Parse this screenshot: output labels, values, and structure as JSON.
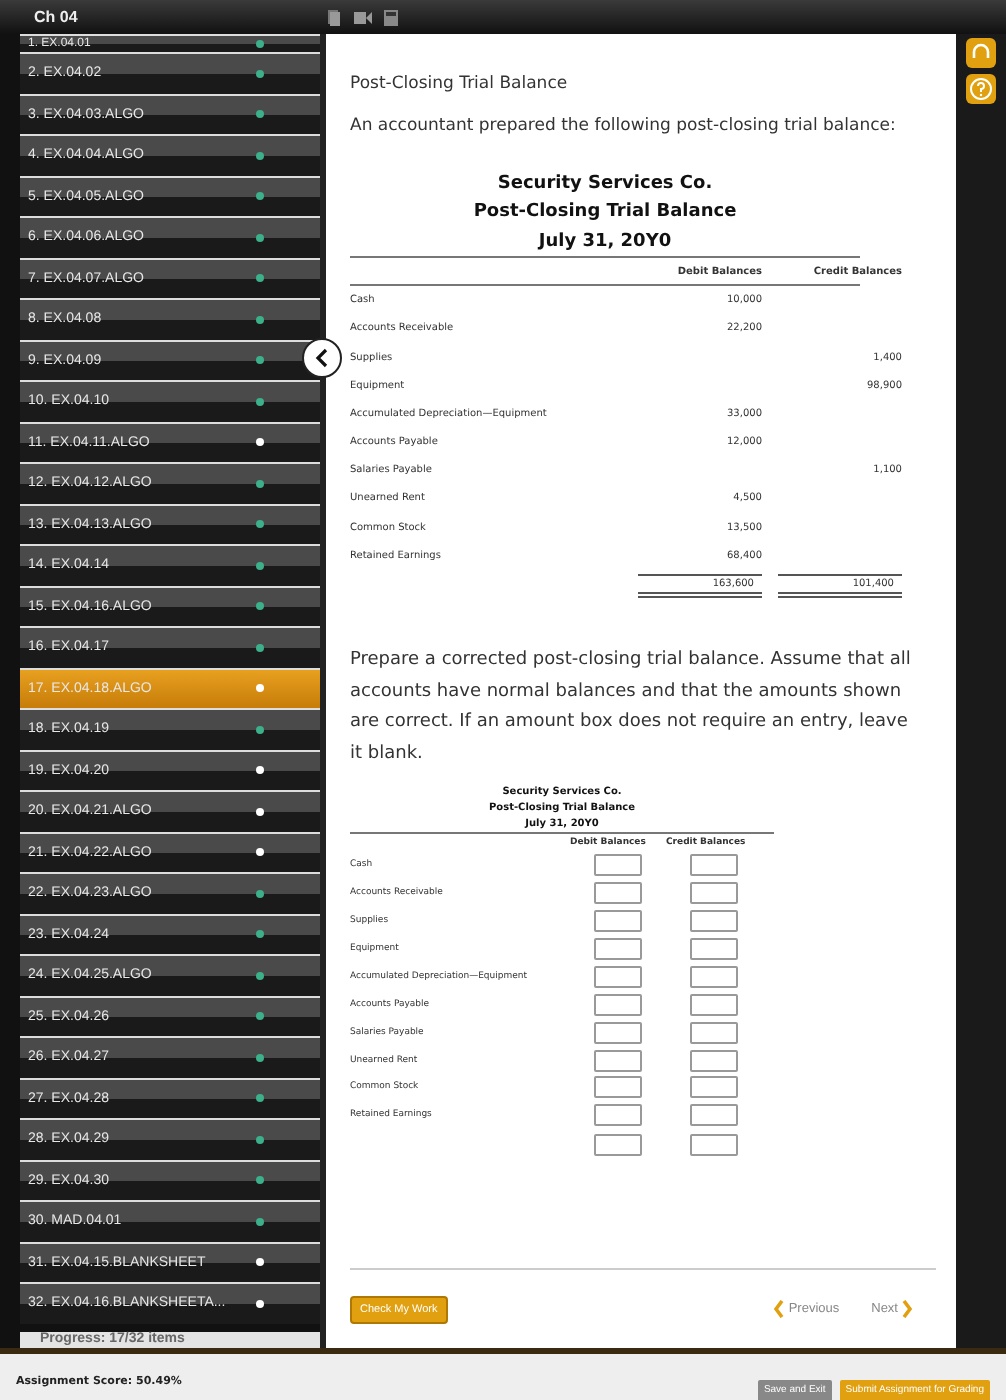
{
  "top_bar": {
    "title": "Ch 04"
  },
  "sidebar": {
    "items": [
      {
        "label": "1. EX.04.01",
        "completed": true,
        "selected": false
      },
      {
        "label": "2. EX.04.02",
        "completed": true,
        "selected": false
      },
      {
        "label": "3. EX.04.03.ALGO",
        "completed": true,
        "selected": false
      },
      {
        "label": "4. EX.04.04.ALGO",
        "completed": true,
        "selected": false
      },
      {
        "label": "5. EX.04.05.ALGO",
        "completed": true,
        "selected": false
      },
      {
        "label": "6. EX.04.06.ALGO",
        "completed": true,
        "selected": false
      },
      {
        "label": "7. EX.04.07.ALGO",
        "completed": true,
        "selected": false
      },
      {
        "label": "8. EX.04.08",
        "completed": true,
        "selected": false
      },
      {
        "label": "9. EX.04.09",
        "completed": true,
        "selected": false
      },
      {
        "label": "10. EX.04.10",
        "completed": true,
        "selected": false
      },
      {
        "label": "11. EX.04.11.ALGO",
        "completed": false,
        "selected": false
      },
      {
        "label": "12. EX.04.12.ALGO",
        "completed": true,
        "selected": false
      },
      {
        "label": "13. EX.04.13.ALGO",
        "completed": true,
        "selected": false
      },
      {
        "label": "14. EX.04.14",
        "completed": true,
        "selected": false
      },
      {
        "label": "15. EX.04.16.ALGO",
        "completed": true,
        "selected": false
      },
      {
        "label": "16. EX.04.17",
        "completed": true,
        "selected": false
      },
      {
        "label": "17. EX.04.18.ALGO",
        "completed": false,
        "selected": true
      },
      {
        "label": "18. EX.04.19",
        "completed": true,
        "selected": false
      },
      {
        "label": "19. EX.04.20",
        "completed": false,
        "selected": false
      },
      {
        "label": "20. EX.04.21.ALGO",
        "completed": false,
        "selected": false
      },
      {
        "label": "21. EX.04.22.ALGO",
        "completed": false,
        "selected": false
      },
      {
        "label": "22. EX.04.23.ALGO",
        "completed": true,
        "selected": false
      },
      {
        "label": "23. EX.04.24",
        "completed": true,
        "selected": false
      },
      {
        "label": "24. EX.04.25.ALGO",
        "completed": true,
        "selected": false
      },
      {
        "label": "25. EX.04.26",
        "completed": true,
        "selected": false
      },
      {
        "label": "26. EX.04.27",
        "completed": true,
        "selected": false
      },
      {
        "label": "27. EX.04.28",
        "completed": true,
        "selected": false
      },
      {
        "label": "28. EX.04.29",
        "completed": true,
        "selected": false
      },
      {
        "label": "29. EX.04.30",
        "completed": true,
        "selected": false
      },
      {
        "label": "30. MAD.04.01",
        "completed": true,
        "selected": false
      },
      {
        "label": "31. EX.04.15.BLANKSHEET",
        "completed": false,
        "selected": false
      },
      {
        "label": "32. EX.04.16.BLANKSHEETA...",
        "completed": false,
        "selected": false
      }
    ],
    "progress": "Progress:  17/32 items"
  },
  "content": {
    "title": "Post-Closing Trial Balance",
    "intro": "An accountant prepared the following post-closing trial balance:",
    "table": {
      "heading": [
        "Security Services Co.",
        "Post-Closing Trial Balance",
        "July 31, 20Y0"
      ],
      "columns": [
        "Debit Balances",
        "Credit Balances"
      ],
      "rows": [
        {
          "account": "Cash",
          "debit": "10,000",
          "credit": ""
        },
        {
          "account": "Accounts Receivable",
          "debit": "22,200",
          "credit": ""
        },
        {
          "account": "Supplies",
          "debit": "",
          "credit": "1,400"
        },
        {
          "account": "Equipment",
          "debit": "",
          "credit": "98,900"
        },
        {
          "account": "Accumulated Depreciation—Equipment",
          "debit": "33,000",
          "credit": ""
        },
        {
          "account": "Accounts Payable",
          "debit": "12,000",
          "credit": ""
        },
        {
          "account": "Salaries Payable",
          "debit": "",
          "credit": "1,100"
        },
        {
          "account": "Unearned Rent",
          "debit": "4,500",
          "credit": ""
        },
        {
          "account": "Common Stock",
          "debit": "13,500",
          "credit": ""
        },
        {
          "account": "Retained Earnings",
          "debit": "68,400",
          "credit": ""
        }
      ],
      "totals": {
        "debit": "163,600",
        "credit": "101,400"
      }
    },
    "instructions": "Prepare a corrected post-closing trial balance. Assume that all accounts have normal balances and that the amounts shown are correct. If an amount box does not require an entry, leave it blank.",
    "answer_table": {
      "heading": [
        "Security Services Co.",
        "Post-Closing Trial Balance",
        "July 31, 20Y0"
      ],
      "columns": [
        "Debit Balances",
        "Credit Balances"
      ],
      "rows": [
        "Cash",
        "Accounts Receivable",
        "Supplies",
        "Equipment",
        "Accumulated Depreciation—Equipment",
        "Accounts Payable",
        "Salaries Payable",
        "Unearned Rent",
        "Common Stock",
        "Retained Earnings"
      ]
    },
    "check_button": "Check My Work",
    "previous": "Previous",
    "next": "Next"
  },
  "footer": {
    "score": "Assignment Score: 50.49%",
    "save": "Save and Exit",
    "submit": "Submit Assignment for Grading"
  }
}
